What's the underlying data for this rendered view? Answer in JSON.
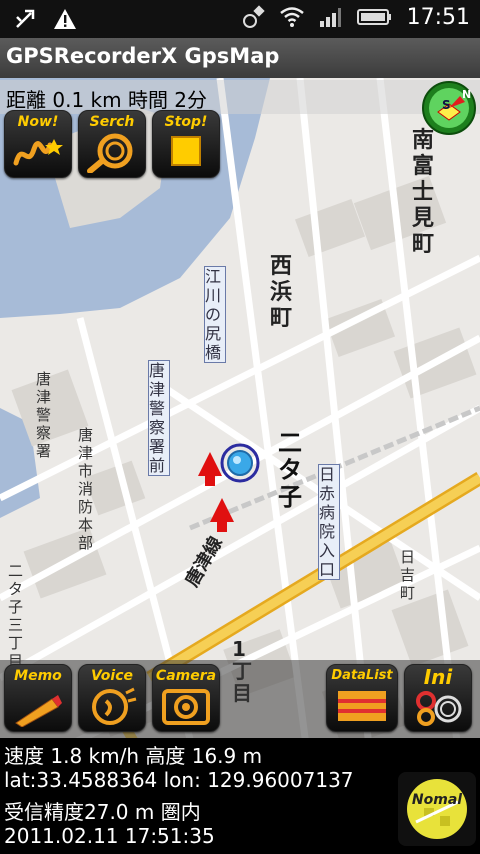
{
  "statusbar": {
    "time": "17:51",
    "icons": [
      "usb-debug-icon",
      "warning-icon",
      "gps-icon",
      "wifi-icon",
      "signal-icon",
      "battery-icon"
    ]
  },
  "titlebar": {
    "title": "GPSRecorderX GpsMap"
  },
  "top_info": {
    "text": "距離 0.1 km  時間 2分"
  },
  "top_buttons": [
    {
      "label": "Now!",
      "icon": "now-icon"
    },
    {
      "label": "Serch",
      "icon": "search-ring-icon"
    },
    {
      "label": "Stop!",
      "icon": "stop-icon"
    }
  ],
  "bottom_buttons": [
    {
      "label": "Memo",
      "icon": "pencil-icon"
    },
    {
      "label": "Voice",
      "icon": "voice-icon"
    },
    {
      "label": "Camera",
      "icon": "camera-icon"
    },
    {
      "label": "DataList",
      "icon": "datalist-icon"
    },
    {
      "label": "Ini",
      "icon": "settings-icon"
    }
  ],
  "map_labels": {
    "minamifujimi": "南富士見町",
    "nishihama": "西浜町",
    "egawa_bridge": "江川の尻橋",
    "karatsu_station": "唐津警察署前",
    "fire_dept": "唐津市消防本部",
    "police": "唐津警察署",
    "futago": "二タ子",
    "nissan": "日赤病院入口",
    "karatsu_line": "唐津線",
    "kome_jidai": "日吉町",
    "town_1": "1丁目",
    "shipyard": "二タ子三丁目"
  },
  "readout": {
    "speed_alt": "速度 1.8 km/h 高度 16.9 m",
    "latlon": "lat:33.4588364 lon: 129.96007137",
    "accuracy": "受信精度27.0 m 圏内",
    "datetime": "2011.02.11 17:51:35"
  },
  "map_mode_button": {
    "label": "Nomal",
    "icon": "map-mode-icon"
  },
  "compass": {
    "icon": "compass-icon",
    "letters": [
      "S",
      "N"
    ]
  },
  "colors": {
    "map_bg": "#ececec",
    "water": "#a3b9d6",
    "highway": "#f2c23a",
    "button_accent": "#ffcc00",
    "marker": "#e01010",
    "location": "#3aa8e8"
  }
}
